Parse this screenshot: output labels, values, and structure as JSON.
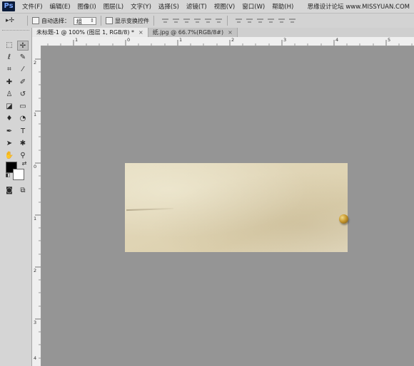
{
  "app": {
    "logo_text": "Ps",
    "menu": [
      "文件(F)",
      "编辑(E)",
      "图像(I)",
      "图层(L)",
      "文字(Y)",
      "选择(S)",
      "滤镜(T)",
      "视图(V)",
      "窗口(W)",
      "帮助(H)"
    ],
    "watermark": "思缘设计论坛 www.MISSYUAN.COM"
  },
  "options_bar": {
    "tool_glyph": "▸✢",
    "auto_select_label": "自动选择：",
    "auto_select_value": "组",
    "show_transform_label": "显示变换控件"
  },
  "tabs": [
    {
      "label": "未标题-1 @ 100% (图层 1, RGB/8) *",
      "close": "×"
    },
    {
      "label": "纸.jpg @ 66.7%(RGB/8#)",
      "close": "×"
    }
  ],
  "rulers": {
    "top_labels": [
      "1",
      "0",
      "1",
      "2",
      "3",
      "4",
      "5",
      "6"
    ],
    "left_labels": [
      "2",
      "1",
      "0",
      "1",
      "2",
      "3",
      "4"
    ]
  },
  "tools": {
    "names": [
      "marquee-icon",
      "move-icon",
      "lasso-icon",
      "quick-select-icon",
      "crop-icon",
      "eyedropper-icon",
      "healing-brush-icon",
      "brush-icon",
      "clone-stamp-icon",
      "history-brush-icon",
      "eraser-icon",
      "gradient-icon",
      "blur-icon",
      "dodge-icon",
      "pen-icon",
      "type-icon",
      "path-select-icon",
      "shape-icon",
      "hand-icon",
      "zoom-icon",
      "quick-mask-icon",
      "screen-mode-icon"
    ]
  },
  "colors": {
    "foreground": "#000000",
    "background": "#ffffff",
    "canvas_gray": "#959595",
    "paper": "#e2d8ba",
    "pin_gold": "#c99a2e"
  }
}
